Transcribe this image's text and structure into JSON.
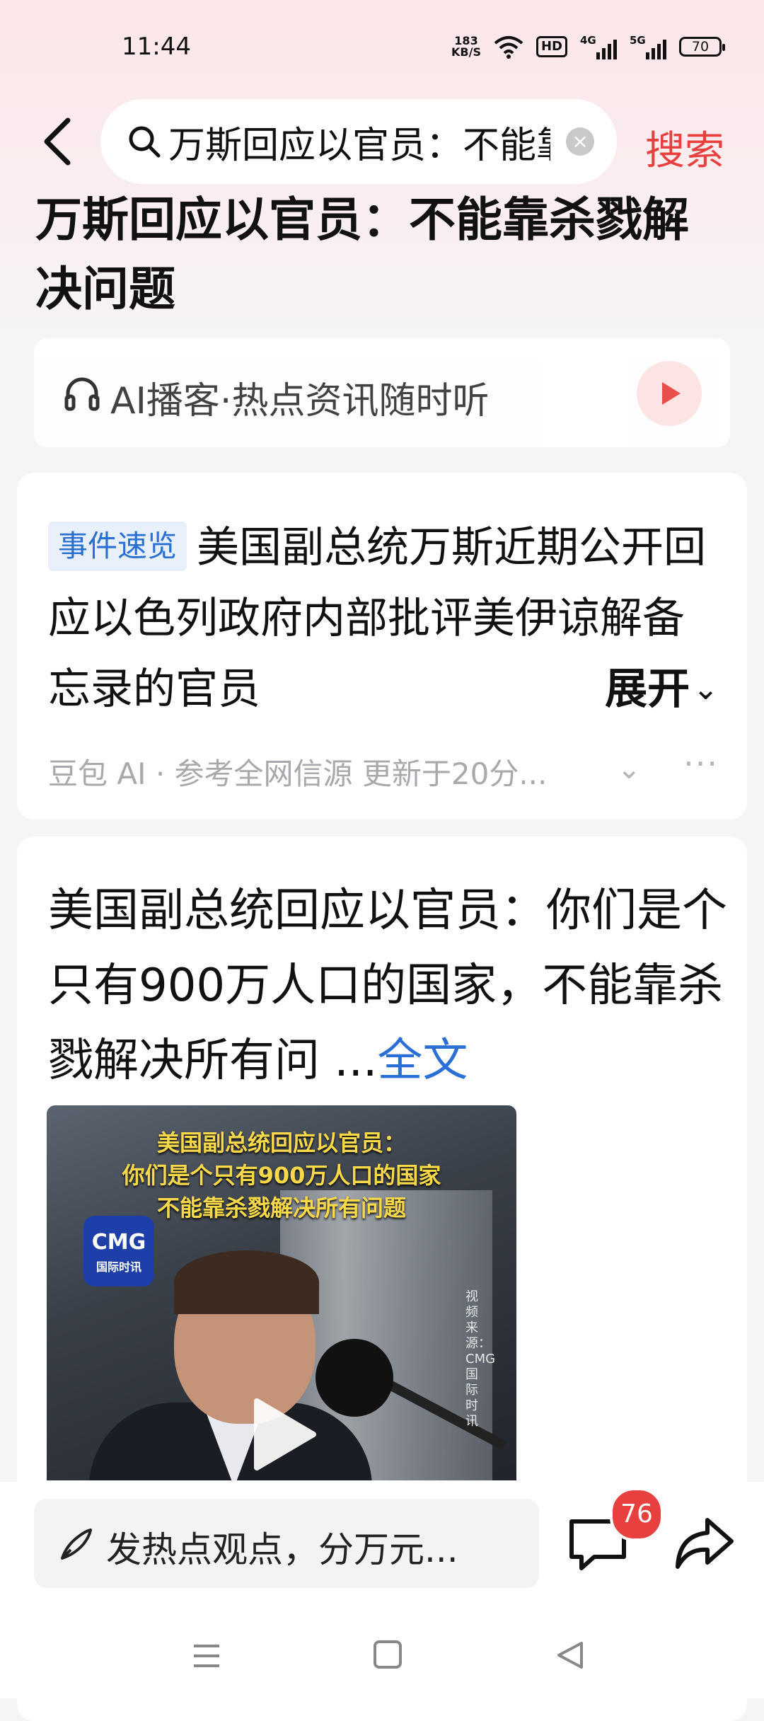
{
  "status_bar": {
    "time": "11:44",
    "net_speed_value": "183",
    "net_speed_unit": "KB/S",
    "hd": "HD",
    "sim1_network": "4G",
    "sim2_network": "5G",
    "battery": "70"
  },
  "search": {
    "query": "万斯回应以官员：不能靠杀戮解决问题",
    "submit_label": "搜索"
  },
  "page": {
    "title": "万斯回应以官员：不能靠杀戮解决问题"
  },
  "podcast": {
    "label": "AI播客·热点资讯随时听"
  },
  "summary_card": {
    "tag": "事件速览",
    "text": "美国副总统万斯近期公开回应以色列政府内部批评美伊谅解备忘录的官员",
    "expand_label": "展开",
    "source": "豆包 AI · 参考全网信源 更新于20分..."
  },
  "article_card": {
    "text": "美国副总统回应以官员：你们是个只有900万人口的国家，不能靠杀戮解决所有问 ...",
    "fulltext_label": "全文",
    "video": {
      "caption_line1": "美国副总统回应以官员：",
      "caption_line2": "你们是个只有900万人口的国家",
      "caption_line3": "不能靠杀戮解决所有问题",
      "logo_main": "CMG",
      "logo_sub": "国际时讯",
      "source_note": "视频来源：CMG国际时讯"
    }
  },
  "bottom_bar": {
    "comment_placeholder": "发热点观点，分万元...",
    "comment_count": "76"
  },
  "colors": {
    "accent_red": "#e8403f",
    "link_blue": "#2a6fd6",
    "tag_bg": "#e8f0fb"
  }
}
